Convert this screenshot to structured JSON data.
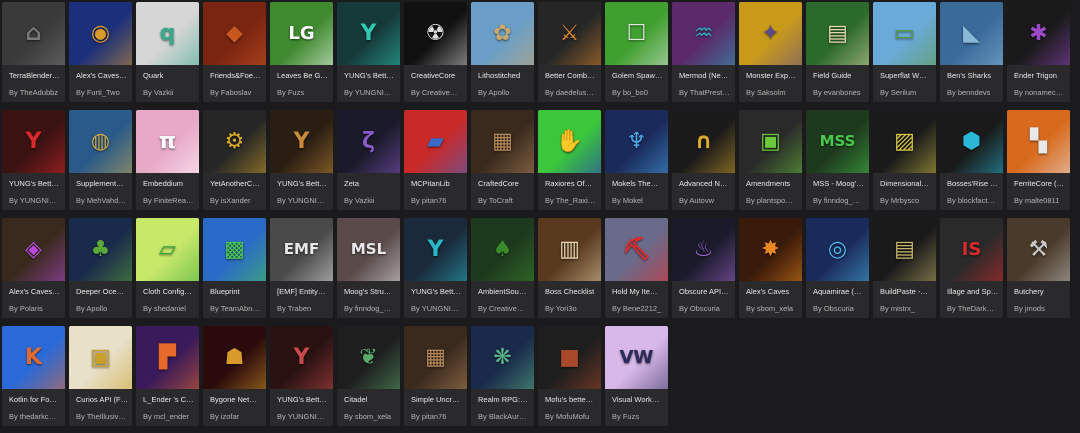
{
  "mods": [
    {
      "title": "TerraBlender…",
      "author": "By TheAdubbz",
      "icon": "blender-icon",
      "glyph": "⌂",
      "bg": "#3a3a3a",
      "accent": "#7a7a7a"
    },
    {
      "title": "Alex's Caves…",
      "author": "By Furti_Two",
      "icon": "golden-mask-icon",
      "glyph": "◉",
      "bg": "#1c2f7a",
      "accent": "#d89a2a"
    },
    {
      "title": "Quark",
      "author": "By Vazkii",
      "icon": "quark-q-icon",
      "glyph": "q",
      "bg": "#d6d6d6",
      "accent": "#3aa88a"
    },
    {
      "title": "Friends&Foe…",
      "author": "By Faboslav",
      "icon": "creature-face-icon",
      "glyph": "◆",
      "bg": "#7a2412",
      "accent": "#c8581e"
    },
    {
      "title": "Leaves Be G…",
      "author": "By Fuzs",
      "icon": "lg-logo-icon",
      "glyph": "LG",
      "bg": "#3f8a2f",
      "accent": "#ffffff"
    },
    {
      "title": "YUNG's Bett…",
      "author": "By YUNGNI…",
      "icon": "yung-y-icon",
      "glyph": "Y",
      "bg": "#163a3a",
      "accent": "#2fc9b5"
    },
    {
      "title": "CreativeCore",
      "author": "By Creative…",
      "icon": "radiation-icon",
      "glyph": "☢",
      "bg": "#111111",
      "accent": "#dddddd"
    },
    {
      "title": "Lithostitched",
      "author": "By Apollo",
      "icon": "landscape-flower-icon",
      "glyph": "✿",
      "bg": "#6a9ec9",
      "accent": "#c9a86a"
    },
    {
      "title": "Better Comb…",
      "author": "By daedelus…",
      "icon": "better-combat-icon",
      "glyph": "⚔",
      "bg": "#262626",
      "accent": "#e08a2a"
    },
    {
      "title": "Golem Spaw…",
      "author": "By bo_bo0",
      "icon": "golem-icon",
      "glyph": "☐",
      "bg": "#3fa02f",
      "accent": "#e6e6e6"
    },
    {
      "title": "Mermod (Ne…",
      "author": "By ThatPrest…",
      "icon": "mermaid-tail-icon",
      "glyph": "♒",
      "bg": "#5a2a6a",
      "accent": "#2fa8b8"
    },
    {
      "title": "Monster Exp…",
      "author": "By Saksolm",
      "icon": "monster-icon",
      "glyph": "✦",
      "bg": "#c99a1a",
      "accent": "#5a4a8a"
    },
    {
      "title": "Field Guide",
      "author": "By evanbones",
      "icon": "book-icon",
      "glyph": "▤",
      "bg": "#2a6a2a",
      "accent": "#e8d8b0"
    },
    {
      "title": "Superflat W…",
      "author": "By Serilum",
      "icon": "flat-world-icon",
      "glyph": "▭",
      "bg": "#6aaad8",
      "accent": "#5a9a3a"
    },
    {
      "title": "Ben's Sharks",
      "author": "By benndevs",
      "icon": "shark-icon",
      "glyph": "◣",
      "bg": "#3a6a9a",
      "accent": "#8ab8d8"
    },
    {
      "title": "Ender Trigon",
      "author": "By nonamec…",
      "icon": "ender-dragon-icon",
      "glyph": "✱",
      "bg": "#1a1a1a",
      "accent": "#9a4ac8"
    },
    {
      "title": "YUNG's Bett…",
      "author": "By YUNGNI…",
      "icon": "yung-y-icon",
      "glyph": "Y",
      "bg": "#3a1212",
      "accent": "#d82a2a"
    },
    {
      "title": "Supplement…",
      "author": "By MehVahd…",
      "icon": "globe-icon",
      "glyph": "◍",
      "bg": "#2a5a8a",
      "accent": "#c9a84a"
    },
    {
      "title": "Embeddium",
      "author": "By FiniteRea…",
      "icon": "pi-icon",
      "glyph": "π",
      "bg": "#e8a8c8",
      "accent": "#ffffff"
    },
    {
      "title": "YetAnotherC…",
      "author": "By isXander",
      "icon": "gear-icon",
      "glyph": "⚙",
      "bg": "#262626",
      "accent": "#d8a82a"
    },
    {
      "title": "YUNG's Bett…",
      "author": "By YUNGNI…",
      "icon": "yung-y-icon",
      "glyph": "Y",
      "bg": "#2a1e12",
      "accent": "#c98a3a"
    },
    {
      "title": "Zeta",
      "author": "By Vazkii",
      "icon": "zeta-icon",
      "glyph": "ζ",
      "bg": "#1a1a2a",
      "accent": "#8a5ac8"
    },
    {
      "title": "MCPitanLib",
      "author": "By pitan76",
      "icon": "blue-book-icon",
      "glyph": "▰",
      "bg": "#c82a2a",
      "accent": "#3a6ac8"
    },
    {
      "title": "CraftedCore",
      "author": "By ToCraft",
      "icon": "crafting-table-icon",
      "glyph": "▦",
      "bg": "#3a2a1e",
      "accent": "#b88a5a"
    },
    {
      "title": "Raxiores Of…",
      "author": "By The_Raxi…",
      "icon": "raxiores-icon",
      "glyph": "✋",
      "bg": "#3ac83a",
      "accent": "#2a2ac8"
    },
    {
      "title": "Mokels The…",
      "author": "By Mokel",
      "icon": "tree-icon",
      "glyph": "♆",
      "bg": "#1a2a5a",
      "accent": "#4aa8e8"
    },
    {
      "title": "Advanced N…",
      "author": "By Autovw",
      "icon": "netherite-helmet-icon",
      "glyph": "∩",
      "bg": "#1a1a1a",
      "accent": "#d8a82a"
    },
    {
      "title": "Amendments",
      "author": "By plantspo…",
      "icon": "cauldron-icon",
      "glyph": "▣",
      "bg": "#2a2a2a",
      "accent": "#6ac83a"
    },
    {
      "title": "MSS - Moog'…",
      "author": "By finndog_…",
      "icon": "mss-logo-icon",
      "glyph": "MSS",
      "bg": "#1e3a1e",
      "accent": "#4ac84a"
    },
    {
      "title": "Dimensional…",
      "author": "By Mrbysco",
      "icon": "painting-icon",
      "glyph": "▨",
      "bg": "#1a1a1a",
      "accent": "#d8c84a"
    },
    {
      "title": "Bosses'Rise (…",
      "author": "By blockfact…",
      "icon": "boss-helmet-icon",
      "glyph": "⬢",
      "bg": "#1a1a1a",
      "accent": "#2ab8d8"
    },
    {
      "title": "FerriteCore (…",
      "author": "By malte0811",
      "icon": "ferrite-pattern-icon",
      "glyph": "▚",
      "bg": "#d86a1e",
      "accent": "#e8e8e8"
    },
    {
      "title": "Alex's Caves…",
      "author": "By Polaris",
      "icon": "purple-gem-icon",
      "glyph": "◈",
      "bg": "#3a2a1e",
      "accent": "#b84ad8"
    },
    {
      "title": "Deeper Oce…",
      "author": "By Apollo",
      "icon": "seaweed-icon",
      "glyph": "♣",
      "bg": "#1a2a4a",
      "accent": "#5aa83a"
    },
    {
      "title": "Cloth Config…",
      "author": "By shedaniel",
      "icon": "cloth-icon",
      "glyph": "▱",
      "bg": "#c8e86a",
      "accent": "#3aa83a"
    },
    {
      "title": "Blueprint",
      "author": "By TeamAbn…",
      "icon": "creeper-icon",
      "glyph": "▩",
      "bg": "#2a6ac8",
      "accent": "#4ac84a"
    },
    {
      "title": "[EMF] Entity…",
      "author": "By Traben",
      "icon": "emf-logo-icon",
      "glyph": "EMF",
      "bg": "#4a4a4a",
      "accent": "#e8e8e8"
    },
    {
      "title": "Moog's Stru…",
      "author": "By finndog_…",
      "icon": "msl-logo-icon",
      "glyph": "MSL",
      "bg": "#5a4a4a",
      "accent": "#e8e8e8"
    },
    {
      "title": "YUNG's Bett…",
      "author": "By YUNGNI…",
      "icon": "yung-y-icon",
      "glyph": "Y",
      "bg": "#1a2a3a",
      "accent": "#2ab8c8"
    },
    {
      "title": "AmbientSou…",
      "author": "By Creative…",
      "icon": "tree-cube-icon",
      "glyph": "♠",
      "bg": "#1e3a1e",
      "accent": "#3a8a2a"
    },
    {
      "title": "Boss Checklist",
      "author": "By Yori3o",
      "icon": "open-book-icon",
      "glyph": "▥",
      "bg": "#5a3a1e",
      "accent": "#e8d8b0"
    },
    {
      "title": "Hold My Ite…",
      "author": "By Bene2212_",
      "icon": "pickaxe-icon",
      "glyph": "⛏",
      "bg": "#6a6a8a",
      "accent": "#e82a2a"
    },
    {
      "title": "Obscure API…",
      "author": "By Obscuria",
      "icon": "jellyfish-icon",
      "glyph": "♨",
      "bg": "#1a1a2a",
      "accent": "#a86ad8"
    },
    {
      "title": "Alex's Caves",
      "author": "By sbom_xela",
      "icon": "explosion-icon",
      "glyph": "✸",
      "bg": "#3a1a0a",
      "accent": "#e8881e"
    },
    {
      "title": "Aquamirae (…",
      "author": "By Obscuria",
      "icon": "blue-orb-icon",
      "glyph": "◎",
      "bg": "#1a2a5a",
      "accent": "#4ab8e8"
    },
    {
      "title": "BuildPaste -…",
      "author": "By mistrx_",
      "icon": "clipboard-icon",
      "glyph": "▤",
      "bg": "#1a1a1a",
      "accent": "#c8b86a"
    },
    {
      "title": "Illage and Sp…",
      "author": "By TheDark…",
      "icon": "illager-icon",
      "glyph": "IS",
      "bg": "#2a2a2a",
      "accent": "#d82a2a"
    },
    {
      "title": "Butchery",
      "author": "By jmods",
      "icon": "cleaver-icon",
      "glyph": "⚒",
      "bg": "#4a3a2a",
      "accent": "#c8c8c8"
    },
    {
      "title": "Kotlin for Fo…",
      "author": "By thedarkc…",
      "icon": "kotlin-logo-icon",
      "glyph": "K",
      "bg": "#2a6ad8",
      "accent": "#e86a2a"
    },
    {
      "title": "Curios API (F…",
      "author": "By TheIllusiv…",
      "icon": "curios-frame-icon",
      "glyph": "▣",
      "bg": "#e8e0c8",
      "accent": "#c8a02a"
    },
    {
      "title": "L_Ender 's C…",
      "author": "By mcl_ender",
      "icon": "ender-gradient-icon",
      "glyph": "▛",
      "bg": "#3a1a5a",
      "accent": "#e86a2a"
    },
    {
      "title": "Bygone Net…",
      "author": "By izofar",
      "icon": "nether-mask-icon",
      "glyph": "☗",
      "bg": "#2a0a0a",
      "accent": "#d89a2a"
    },
    {
      "title": "YUNG's Bett…",
      "author": "By YUNGNI…",
      "icon": "yung-y-icon",
      "glyph": "Y",
      "bg": "#2a1212",
      "accent": "#c84a4a"
    },
    {
      "title": "Citadel",
      "author": "By sbom_xela",
      "icon": "leaf-icon",
      "glyph": "❦",
      "bg": "#1e1e1e",
      "accent": "#5aa86a"
    },
    {
      "title": "Simple Uncr…",
      "author": "By pitan76",
      "icon": "crafting-table-icon",
      "glyph": "▦",
      "bg": "#3a2a1e",
      "accent": "#b88a5a"
    },
    {
      "title": "Realm RPG:…",
      "author": "By BlackAur…",
      "icon": "realm-rpg-icon",
      "glyph": "❋",
      "bg": "#1a2a4a",
      "accent": "#5ab88a"
    },
    {
      "title": "Mofu's bette…",
      "author": "By MofuMofu",
      "icon": "netherrack-cube-icon",
      "glyph": "■",
      "bg": "#1e1e1e",
      "accent": "#a84a2a"
    },
    {
      "title": "Visual Work…",
      "author": "By Fuzs",
      "icon": "vw-logo-icon",
      "glyph": "VW",
      "bg": "#d8b8e8",
      "accent": "#2a2a5a"
    }
  ],
  "colors": {
    "background": "#1b1b1d",
    "card": "#2a2a2d",
    "title_text": "#e8e8e8",
    "author_text": "#b3b3b3"
  }
}
